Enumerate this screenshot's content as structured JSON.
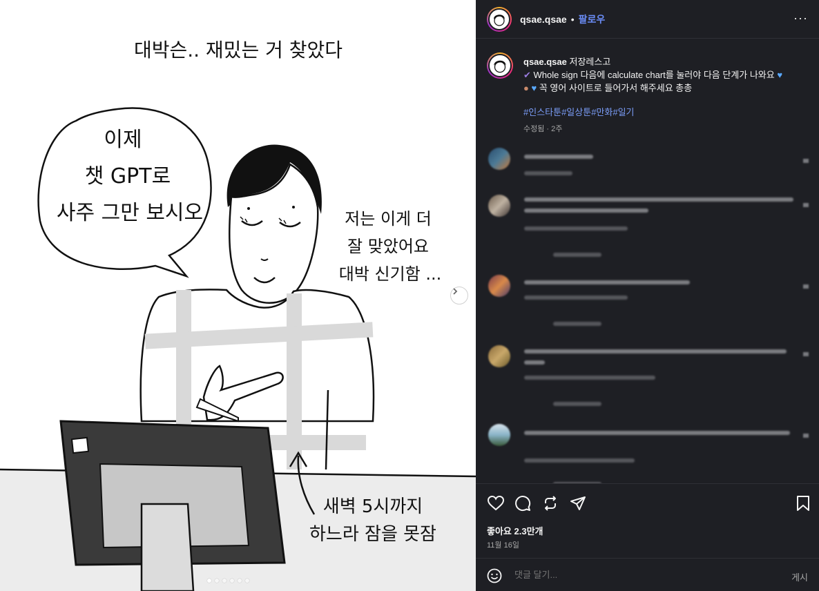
{
  "comic": {
    "title": "대박슨.. 재밌는 거 찾았다",
    "bubble_left": [
      "이제",
      "챗 GPT로",
      "사주 그만 보시오"
    ],
    "text_right": [
      "저는 이게 더",
      "잘 맞았어요",
      "대박 신기함 ..."
    ],
    "text_bottom": [
      "새벽 5시까지",
      "하느라 잠을 못잠"
    ],
    "next_icon": "chevron-right-icon"
  },
  "header": {
    "username": "qsae.qsae",
    "separator": "•",
    "follow_label": "팔로우",
    "more_icon": "more-horizontal-icon",
    "more_label": "···"
  },
  "caption": {
    "username": "qsae.qsae",
    "title": "저장레스고",
    "line1": "Whole sign 다음에 calculate chart를 눌러야 다음 단계가 나와요",
    "line2": "꼭 영어 사이트로 들어가서 해주세요 총총",
    "hashtags": [
      "#인스타툰",
      "#일상툰",
      "#만화",
      "#일기"
    ],
    "edited": "수정됨 · 2주"
  },
  "actions": {
    "likes": "좋아요 2.3만개",
    "date": "11월 16일"
  },
  "add_comment": {
    "placeholder": "댓글 달기...",
    "post_label": "게시"
  },
  "colors": {
    "panel_bg": "#1e1f24",
    "link_blue": "#6b8df7",
    "hashtag_blue": "#7b9df8",
    "muted": "#a8a8a8"
  }
}
